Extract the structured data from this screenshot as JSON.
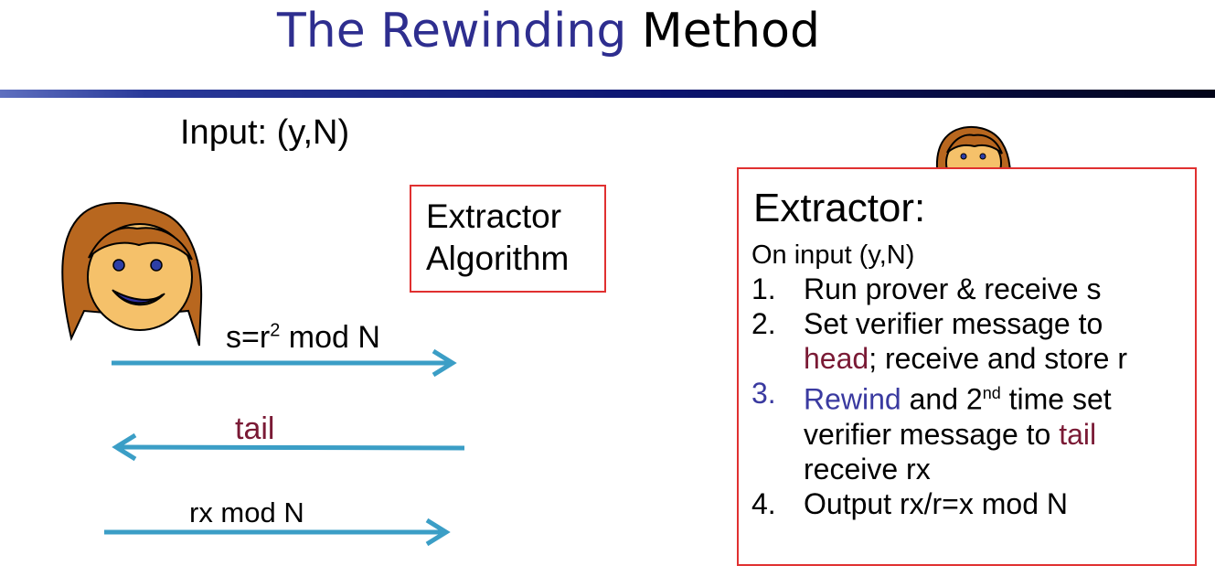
{
  "title": {
    "accent": "The Rewinding",
    "rest": " Method"
  },
  "input_label": "Input: (y,N)",
  "extractor_box": {
    "line1": "Extractor",
    "line2": "Algorithm"
  },
  "messages": {
    "first": {
      "base": "s=r",
      "exp": "2",
      "rest": " mod N"
    },
    "second": "tail",
    "third": "rx mod N"
  },
  "panel": {
    "title": "Extractor:",
    "subtitle": "On input (y,N)",
    "steps": {
      "s1": {
        "num": "1.",
        "text": "Run prover & receive s"
      },
      "s2": {
        "num": "2.",
        "line1": "Set verifier message to",
        "head": "head",
        "line2_rest": "; receive and store r"
      },
      "s3": {
        "num": "3.",
        "rewind": "Rewind",
        "mid": " and 2",
        "sup": "nd",
        "after": " time set",
        "line2": "verifier message to ",
        "tail": "tail",
        "line3": "receive rx"
      },
      "s4": {
        "num": "4.",
        "text": "Output rx/r=x mod N"
      }
    }
  },
  "colors": {
    "title_accent": "#2e2e8f",
    "arrow": "#3b9ec6",
    "tail": "#7a1a35",
    "box_border": "#e03030",
    "rule": "#0b1470"
  },
  "icons": {
    "large": "prover-face-icon",
    "small": "prover-face-icon"
  }
}
